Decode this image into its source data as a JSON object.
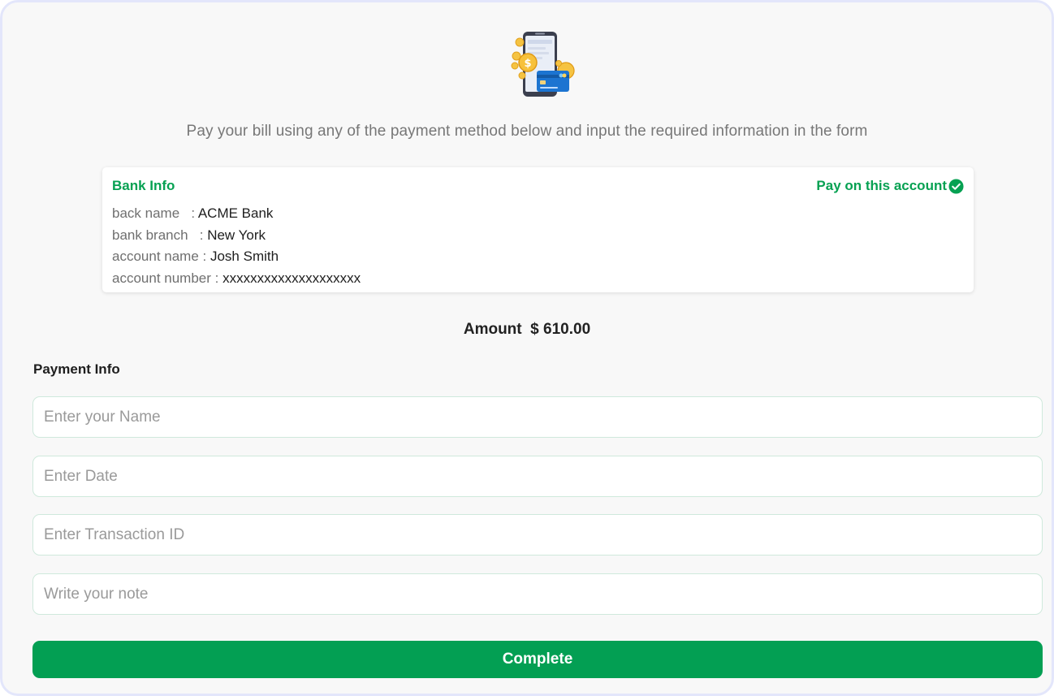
{
  "hero": {
    "icon": "phone-payment-illustration"
  },
  "intro": {
    "text": "Pay your bill using any of the payment method below and input the required information in the form"
  },
  "bank_info": {
    "title": "Bank Info",
    "pay_label": "Pay on this account",
    "rows": [
      {
        "label": "back name   : ",
        "value": "ACME Bank"
      },
      {
        "label": "bank branch   : ",
        "value": "New York"
      },
      {
        "label": "account name : ",
        "value": "Josh Smith"
      },
      {
        "label": "account number : ",
        "value": "xxxxxxxxxxxxxxxxxxxx"
      }
    ]
  },
  "amount": {
    "text": "Amount  $ 610.00"
  },
  "payment_info": {
    "title": "Payment Info",
    "fields": [
      {
        "placeholder": "Enter your Name",
        "value": ""
      },
      {
        "placeholder": "Enter Date",
        "value": ""
      },
      {
        "placeholder": "Enter Transaction ID",
        "value": ""
      },
      {
        "placeholder": "Write your note",
        "value": ""
      }
    ],
    "submit_label": "Complete"
  },
  "colors": {
    "accent": "#039f53",
    "field_border": "#cfe9dc",
    "frame_border": "#e3e6fb"
  }
}
